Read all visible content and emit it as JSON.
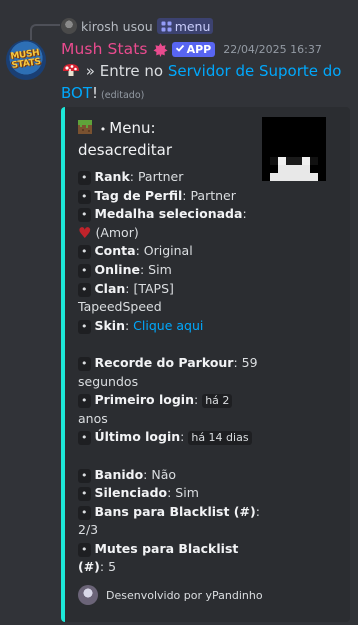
{
  "reply": {
    "username": "kirosh",
    "action": "usou",
    "command": "menu"
  },
  "message": {
    "author": "Mush Stats",
    "badge": "APP",
    "timestamp": "22/04/2025 16:37",
    "text_before": "» Entre no ",
    "link_text": "Servidor de Suporte do BOT",
    "text_after": "!",
    "edited": "(editado)"
  },
  "embed": {
    "accent_color": "#1de9d9",
    "title_line1": "Menu:",
    "title_line2": "desacreditar",
    "bullet": "•",
    "rank_label": "Rank",
    "rank_value": "Partner",
    "tag_label": "Tag de Perfil",
    "tag_value": "Partner",
    "medal_label": "Medalha selecionada",
    "medal_value": "(Amor)",
    "account_label": "Conta",
    "account_value": "Original",
    "online_label": "Online",
    "online_value": "Sim",
    "clan_label": "Clan",
    "clan_value": "[TAPS]",
    "clan_name": "TapeedSpeed",
    "skin_label": "Skin",
    "skin_link": "Clique aqui",
    "parkour_label": "Recorde do Parkour",
    "parkour_value_a": "59",
    "parkour_value_b": "segundos",
    "first_login_label": "Primeiro login",
    "first_login_value_a": "há 2",
    "first_login_value_b": "anos",
    "last_login_label": "Último login",
    "last_login_value": "há 14 dias",
    "banned_label": "Banido",
    "banned_value": "Não",
    "muted_label": "Silenciado",
    "muted_value": "Sim",
    "bans_label": "Bans para Blacklist (#)",
    "bans_value": "2/3",
    "mutes_label_a": "Mutes para Blacklist",
    "mutes_label_b": "(#)",
    "mutes_value": "5",
    "footer": "Desenvolvido por yPandinho"
  },
  "colors": {
    "background": "#313338",
    "embed_bg": "#2b2d31",
    "author": "#e94b8e",
    "link": "#00a8fc",
    "app_badge": "#5865f2"
  }
}
